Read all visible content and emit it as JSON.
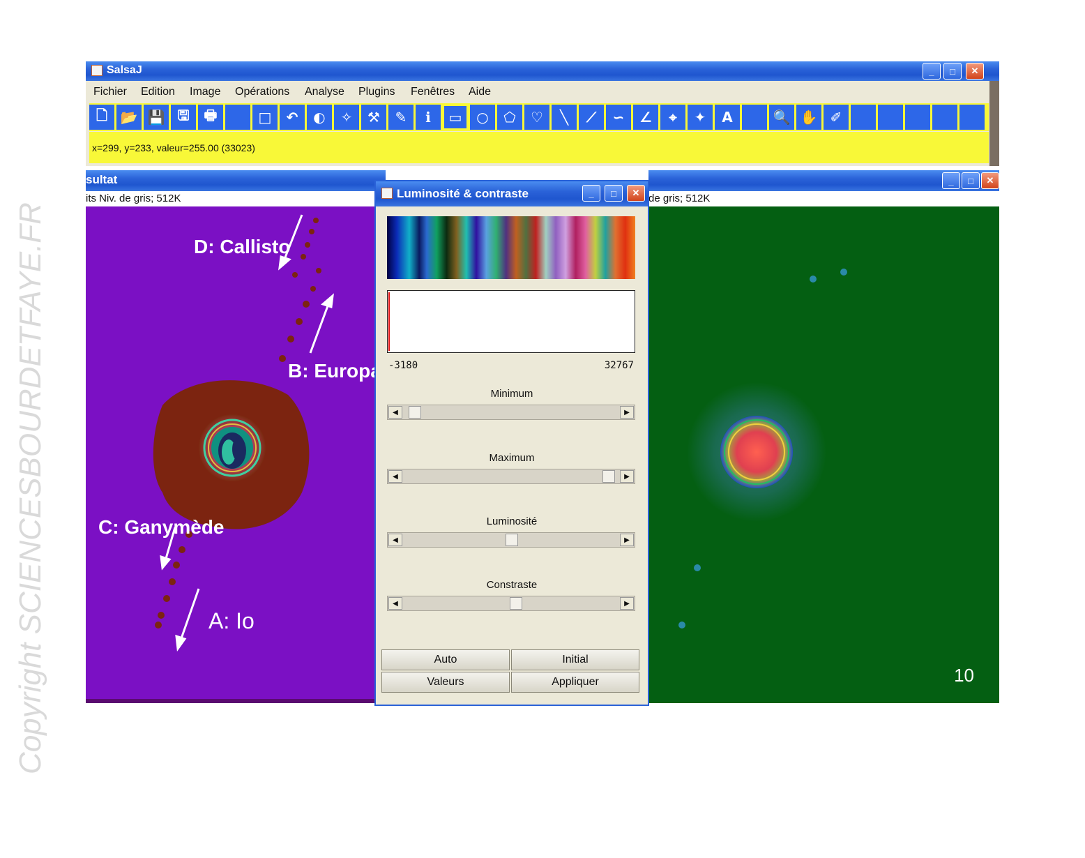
{
  "watermark": "Copyright SCIENCESBOURDETFAYE.FR",
  "main_window": {
    "title": "SalsaJ",
    "menu": [
      "Fichier",
      "Edition",
      "Image",
      "Opérations",
      "Analyse",
      "Plugins",
      "Fenêtres",
      "Aide"
    ],
    "tools": [
      "new-file-icon",
      "open-folder-icon",
      "save-icon",
      "save-all-icon",
      "print-icon",
      "blank",
      "blank-square-icon",
      "undo-icon",
      "contrast-icon",
      "magic-wand-icon",
      "tools-icon",
      "eraser-icon",
      "info-icon",
      "rectangle-select-icon",
      "oval-select-icon",
      "polygon-select-icon",
      "freehand-select-icon",
      "line-icon",
      "segmented-line-icon",
      "freehand-line-icon",
      "angle-icon",
      "point-icon",
      "wand-select-icon",
      "text-icon",
      "blank",
      "magnifier-icon",
      "hand-icon",
      "dropper-icon",
      "blank",
      "blank",
      "blank",
      "blank",
      "blank"
    ],
    "status": "x=299, y=233, valeur=255.00 (33023)"
  },
  "left_window": {
    "title": "sultat",
    "info": "its Niv. de gris; 512K",
    "annotations": {
      "d": "D: Callisto",
      "b": "B: Europa",
      "c": "C: Ganymède",
      "a": "A: Io"
    }
  },
  "right_window": {
    "info": "de gris; 512K",
    "frame_number": "10"
  },
  "dialog": {
    "title": "Luminosité & contraste",
    "range_min": "-3180",
    "range_max": "32767",
    "sliders": [
      {
        "label": "Minimum",
        "value": 0.03
      },
      {
        "label": "Maximum",
        "value": 0.97
      },
      {
        "label": "Luminosité",
        "value": 0.5
      },
      {
        "label": "Constraste",
        "value": 0.52
      }
    ],
    "buttons": {
      "auto": "Auto",
      "initial": "Initial",
      "values": "Valeurs",
      "apply": "Appliquer"
    }
  }
}
